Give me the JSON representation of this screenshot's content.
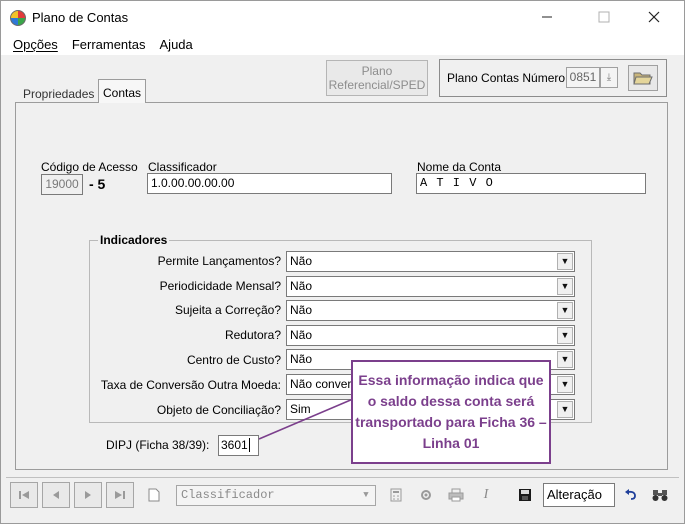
{
  "window": {
    "title": "Plano de Contas"
  },
  "menu": [
    {
      "label": "Opções"
    },
    {
      "label": "Ferramentas"
    },
    {
      "label": "Ajuda"
    }
  ],
  "toolbar": {
    "plano_button_line1": "Plano",
    "plano_button_line2": "Referencial/SPED",
    "plano_numero_label": "Plano Contas Número",
    "plano_numero_value": "0851"
  },
  "tabs": [
    {
      "label": "Propriedades"
    },
    {
      "label": "Contas",
      "active": true
    }
  ],
  "conta": {
    "codigo_label": "Código de Acesso",
    "codigo_value": "19000",
    "digito": "- 5",
    "classificador_label": "Classificador",
    "classificador_value": "1.0.00.00.00.00",
    "nome_label": "Nome da Conta",
    "nome_value": "A T I V O"
  },
  "indicadores": {
    "title": "Indicadores",
    "rows": [
      {
        "label": "Permite Lançamentos?",
        "value": "Não"
      },
      {
        "label": "Periodicidade Mensal?",
        "value": "Não"
      },
      {
        "label": "Sujeita a Correção?",
        "value": "Não"
      },
      {
        "label": "Redutora?",
        "value": "Não"
      },
      {
        "label": "Centro de Custo?",
        "value": "Não"
      },
      {
        "label": "Taxa de Conversão Outra Moeda:",
        "value": "Não convert"
      },
      {
        "label": "Objeto de Conciliação?",
        "value": "Sim"
      }
    ]
  },
  "dipj": {
    "label": "DIPJ (Ficha 38/39):",
    "value": "3601"
  },
  "callout": {
    "text": "Essa informação indica que o saldo dessa conta será transportado para Ficha 36 – Linha 01"
  },
  "navigator": {
    "select_value": "Classificador",
    "status": "Alteração"
  },
  "colors": {
    "callout": "#7b3f8c",
    "background": "#f0f0f0"
  }
}
